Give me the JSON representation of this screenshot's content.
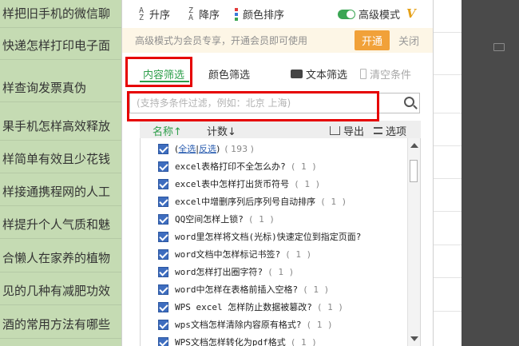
{
  "background": {
    "rows": [
      "样把旧手机的微信聊",
      "快递怎样打印电子面",
      "样查询发票真伪",
      "果手机怎样高效释放",
      "样简单有效且少花钱",
      "样接通携程网的人工",
      "样提升个人气质和魅",
      "合懒人在家养的植物",
      "见的几种有减肥功效",
      "酒的常用方法有哪些"
    ]
  },
  "sortbar": {
    "asc": "升序",
    "desc": "降序",
    "color_sort": "颜色排序",
    "advanced_mode": "高级模式",
    "vip_icon": "V"
  },
  "notice": {
    "text": "高级模式为会员专享，开通会员即可使用",
    "open": "开通",
    "close": "关闭"
  },
  "tabs": {
    "content_filter": "内容筛选",
    "color_filter": "颜色筛选",
    "text_filter": "文本筛选",
    "clear": "清空条件"
  },
  "search": {
    "placeholder": "(支持多条件过滤，例如：北京 上海)"
  },
  "header": {
    "name": "名称↑",
    "count": "计数↓",
    "export": "导出",
    "options": "选项"
  },
  "list": {
    "select_all": "全选",
    "invert": "反选",
    "total": "( 193 )",
    "items": [
      {
        "label": "excel表格打印不全怎么办?",
        "count": "( 1 )"
      },
      {
        "label": "excel表中怎样打出货币符号",
        "count": "( 1 )"
      },
      {
        "label": "excel中增删序列后序列号自动排序",
        "count": "( 1 )"
      },
      {
        "label": "QQ空间怎样上锁?",
        "count": "( 1 )"
      },
      {
        "label": "word里怎样将文档(光标)快速定位到指定页面?",
        "count": ""
      },
      {
        "label": "word文档中怎样标记书签?",
        "count": "( 1 )"
      },
      {
        "label": "word怎样打出圈字符?",
        "count": "( 1 )"
      },
      {
        "label": "word中怎样在表格前插入空格?",
        "count": "( 1 )"
      },
      {
        "label": "WPS excel 怎样防止数据被篡改?",
        "count": "( 1 )"
      },
      {
        "label": "wps文档怎样清除内容原有格式?",
        "count": "( 1 )"
      },
      {
        "label": "WPS文档怎样转化为pdf格式",
        "count": "( 1 )"
      }
    ]
  },
  "colors": {
    "accent_green": "#2d9e4a",
    "highlight_red": "#e60000",
    "open_orange": "#f1a139",
    "checkbox_blue": "#3e6dbf"
  }
}
